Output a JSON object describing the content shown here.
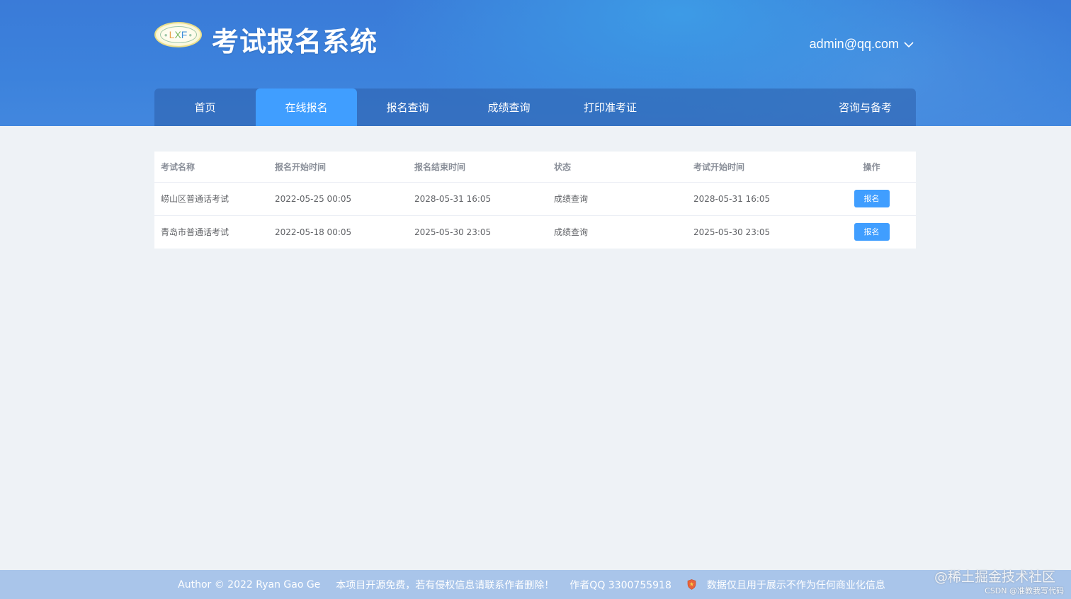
{
  "header": {
    "logo_text": [
      "L",
      "X",
      "F"
    ],
    "app_title": "考试报名系统",
    "user_email": "admin@qq.com"
  },
  "nav": {
    "items": [
      {
        "label": "首页",
        "active": false
      },
      {
        "label": "在线报名",
        "active": true
      },
      {
        "label": "报名查询",
        "active": false
      },
      {
        "label": "成绩查询",
        "active": false
      },
      {
        "label": "打印准考证",
        "active": false
      },
      {
        "label": "咨询与备考",
        "active": false
      }
    ]
  },
  "table": {
    "headers": [
      "考试名称",
      "报名开始时间",
      "报名结束时间",
      "状态",
      "考试开始时间",
      "操作"
    ],
    "rows": [
      {
        "name": "崂山区普通话考试",
        "reg_start": "2022-05-25 00:05",
        "reg_end": "2028-05-31 16:05",
        "status": "成绩查询",
        "exam_start": "2028-05-31 16:05",
        "action": "报名"
      },
      {
        "name": "青岛市普通话考试",
        "reg_start": "2022-05-18 00:05",
        "reg_end": "2025-05-30 23:05",
        "status": "成绩查询",
        "exam_start": "2025-05-30 23:05",
        "action": "报名"
      }
    ]
  },
  "footer": {
    "author": "Author © 2022 Ryan Gao Ge",
    "disclaimer": "本项目开源免费，若有侵权信息请联系作者删除！",
    "qq": "作者QQ 3300755918",
    "notice": "数据仅且用于展示不作为任何商业化信息"
  },
  "watermark": {
    "main": "@稀土掘金技术社区",
    "sub": "CSDN @准教我写代码"
  },
  "colors": {
    "header_blue": "#3c80da",
    "accent": "#409eff",
    "footer_bg": "#a9c5ea",
    "page_bg": "#eef2f6"
  }
}
